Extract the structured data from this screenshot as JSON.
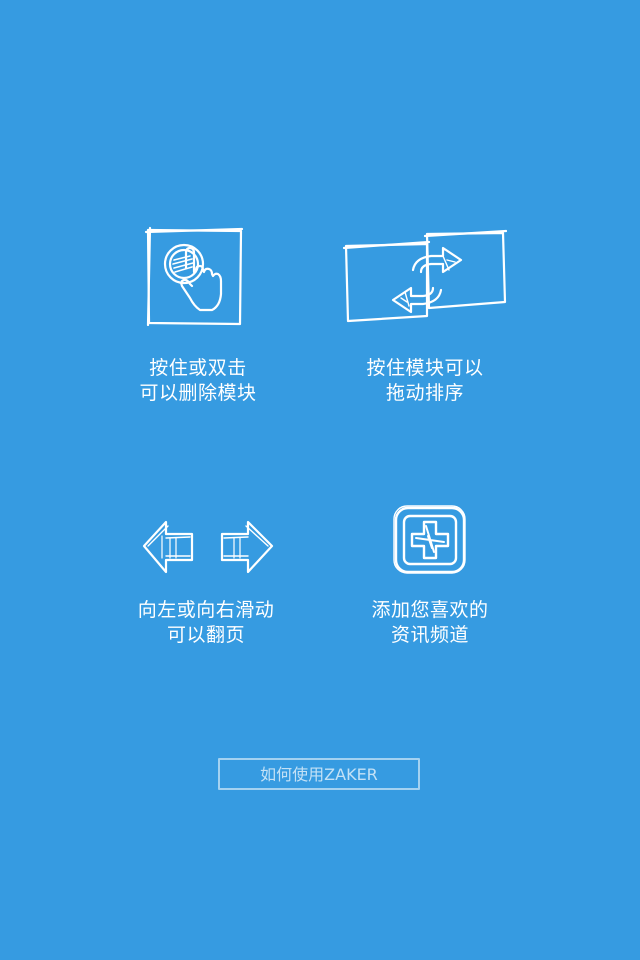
{
  "tips": {
    "delete": {
      "line1": "按住或双击",
      "line2": "可以删除模块",
      "icon": "tap-hand-icon"
    },
    "drag": {
      "line1": "按住模块可以",
      "line2": "拖动排序",
      "icon": "swap-arrows-icon"
    },
    "swipe": {
      "line1": "向左或向右滑动",
      "line2": "可以翻页",
      "icon": "left-right-arrows-icon"
    },
    "add": {
      "line1": "添加您喜欢的",
      "line2": "资讯频道",
      "icon": "plus-box-icon"
    }
  },
  "how_to_button": {
    "label": "如何使用ZAKER"
  },
  "colors": {
    "background": "#369be1",
    "foreground": "#ffffff"
  }
}
